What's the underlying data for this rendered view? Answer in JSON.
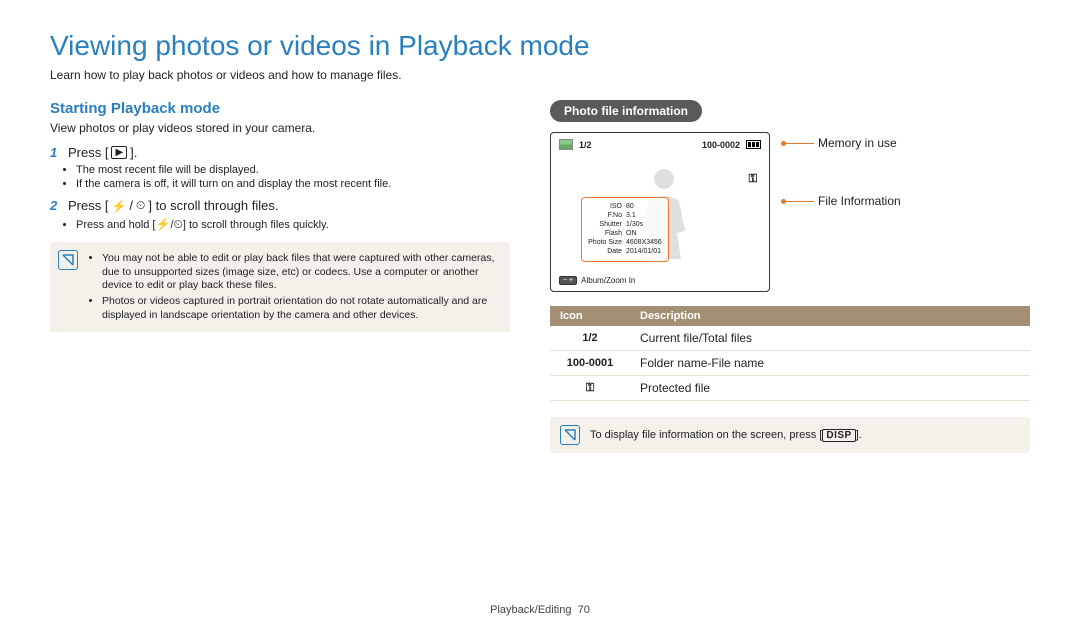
{
  "title": "Viewing photos or videos in Playback mode",
  "intro": "Learn how to play back photos or videos and how to manage files.",
  "left": {
    "subhead": "Starting Playback mode",
    "lead": "View photos or play videos stored in your camera.",
    "step1_num": "1",
    "step1_pre": "Press [",
    "step1_icon": "▶",
    "step1_post": "].",
    "step1_b1": "The most recent file will be displayed.",
    "step1_b2": "If the camera is off, it will turn on and display the most recent file.",
    "step2_num": "2",
    "step2_pre": "Press [",
    "step2_icon1": "⚡",
    "step2_sep": "/",
    "step2_icon2": "⏲",
    "step2_post": "] to scroll through files.",
    "step2_b1_pre": "Press and hold [",
    "step2_b1_post": "] to scroll through files quickly.",
    "note1": "You may not be able to edit or play back files that were captured with other cameras, due to unsupported sizes (image size, etc) or codecs. Use a computer or another device to edit or play back these files.",
    "note2": "Photos or videos captured in portrait orientation do not rotate automatically and are displayed in landscape orientation by the camera and other devices."
  },
  "right": {
    "pill": "Photo file information",
    "lcd": {
      "count": "1/2",
      "folder": "100-0002",
      "info": {
        "iso_k": "ISO",
        "iso_v": "80",
        "fno_k": "F.No",
        "fno_v": "3.1",
        "sh_k": "Shutter",
        "sh_v": "1/30s",
        "fl_k": "Flash",
        "fl_v": "ON",
        "ps_k": "Photo Size",
        "ps_v": "4608X3456",
        "dt_k": "Date",
        "dt_v": "2014/01/01"
      },
      "bottom": "Album/Zoom In"
    },
    "leader1": "Memory in use",
    "leader2": "File Information",
    "tbl": {
      "h1": "Icon",
      "h2": "Description",
      "r1_icon": "1/2",
      "r1_desc": "Current file/Total files",
      "r2_icon": "100-0001",
      "r2_desc": "Folder name-File name",
      "r3_desc": "Protected file"
    },
    "tip_pre": "To display file information on the screen, press [",
    "tip_disp": "DISP",
    "tip_post": "]."
  },
  "footer_section": "Playback/Editing",
  "footer_page": "70"
}
